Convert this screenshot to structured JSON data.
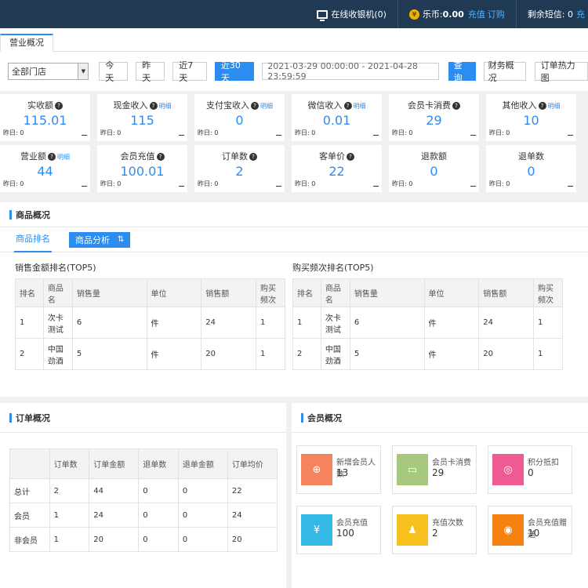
{
  "topbar": {
    "online_label": "在线收银机(0)",
    "coin_label": "乐币:",
    "coin_value": "0.00",
    "recharge": "充值",
    "subscribe": "订购",
    "sms_label": "剩余短信: 0",
    "sms_tail": "充"
  },
  "tabs": {
    "active": "营业概况"
  },
  "filter": {
    "store": "全部门店",
    "today": "今天",
    "yesterday": "昨天",
    "last7": "近7天",
    "last30": "近30天",
    "date_range": "2021-03-29 00:00:00 - 2021-04-28 23:59:59",
    "query": "查询",
    "finance": "财务概况",
    "heatmap": "订单热力图"
  },
  "stats": [
    {
      "label": "实收额",
      "value": "115.01",
      "yest": "昨日: 0"
    },
    {
      "label": "现金收入",
      "value": "115",
      "yest": "昨日: 0",
      "detail": "明细"
    },
    {
      "label": "支付宝收入",
      "value": "0",
      "yest": "昨日: 0",
      "detail": "明细"
    },
    {
      "label": "微信收入",
      "value": "0.01",
      "yest": "昨日: 0",
      "detail": "明细"
    },
    {
      "label": "会员卡消费",
      "value": "29",
      "yest": "昨日: 0"
    },
    {
      "label": "其他收入",
      "value": "10",
      "yest": "昨日: 0",
      "detail": "明细"
    },
    {
      "label": "营业额",
      "value": "44",
      "yest": "昨日: 0",
      "detail": "明细"
    },
    {
      "label": "会员充值",
      "value": "100.01",
      "yest": "昨日: 0"
    },
    {
      "label": "订单数",
      "value": "2",
      "yest": "昨日: 0"
    },
    {
      "label": "客单价",
      "value": "22",
      "yest": "昨日: 0"
    },
    {
      "label": "退款额",
      "value": "0",
      "yest": "昨日: 0"
    },
    {
      "label": "退单数",
      "value": "0",
      "yest": "昨日: 0"
    }
  ],
  "goods": {
    "title": "商品概况",
    "tab_rank": "商品排名",
    "tab_analysis": "商品分析",
    "sales_title": "销售金额排名(TOP5)",
    "freq_title": "购买频次排名(TOP5)",
    "headers": [
      "排名",
      "商品名",
      "销售量",
      "单位",
      "销售额",
      "购买频次"
    ],
    "rows": [
      [
        "1",
        "次卡测试",
        "6",
        "件",
        "24",
        "1"
      ],
      [
        "2",
        "中国劲酒",
        "5",
        "件",
        "20",
        "1"
      ]
    ]
  },
  "orders": {
    "title": "订单概况",
    "headers": [
      "",
      "订单数",
      "订单金额",
      "退单数",
      "退单金额",
      "订单均价"
    ],
    "rows": [
      [
        "总计",
        "2",
        "44",
        "0",
        "0",
        "22"
      ],
      [
        "会员",
        "1",
        "24",
        "0",
        "0",
        "24"
      ],
      [
        "非会员",
        "1",
        "20",
        "0",
        "0",
        "20"
      ]
    ]
  },
  "members": {
    "title": "会员概况",
    "cards": [
      {
        "label": "新增会员人数",
        "value": "13",
        "color": "#f5835f",
        "icon": "add-user-icon"
      },
      {
        "label": "会员卡消费",
        "value": "29",
        "color": "#a7c97f",
        "icon": "card-icon"
      },
      {
        "label": "积分抵扣",
        "value": "0",
        "color": "#ee5b94",
        "icon": "coins-icon"
      },
      {
        "label": "会员充值",
        "value": "100",
        "color": "#35b8e6",
        "icon": "yuan-icon"
      },
      {
        "label": "充值次数",
        "value": "2",
        "color": "#f7c01c",
        "icon": "users-icon"
      },
      {
        "label": "会员充值赠送",
        "value": "10",
        "color": "#f5820f",
        "icon": "gift-coin-icon"
      }
    ]
  }
}
